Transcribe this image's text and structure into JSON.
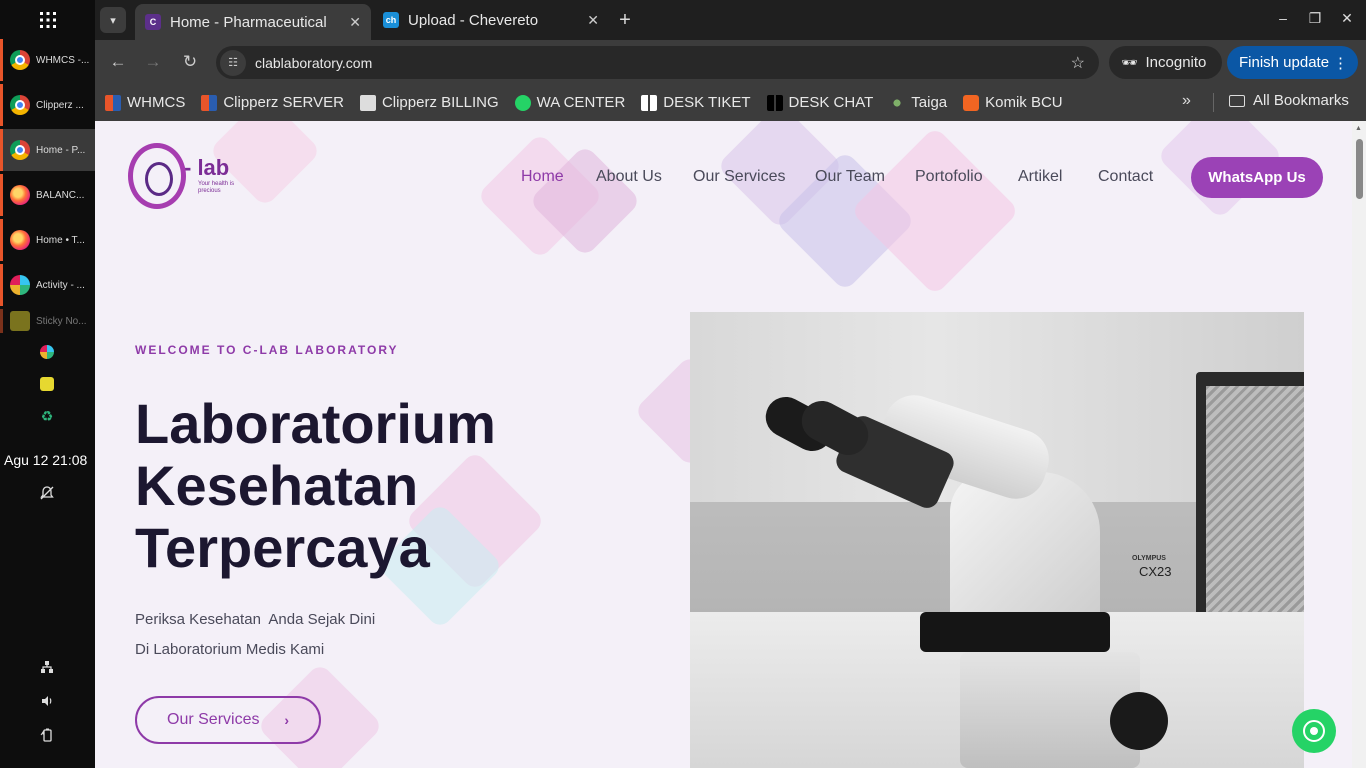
{
  "taskbar": {
    "items": [
      {
        "label": "WHMCS -...",
        "icon": "chrome-icon"
      },
      {
        "label": "Clipperz ...",
        "icon": "chrome-icon"
      },
      {
        "label": "Home - P...",
        "icon": "chrome-icon"
      },
      {
        "label": "BALANC...",
        "icon": "firefox-icon"
      },
      {
        "label": "Home • T...",
        "icon": "firefox-icon"
      },
      {
        "label": "Activity - ...",
        "icon": "slack-icon"
      },
      {
        "label": "Sticky No...",
        "icon": "sticky-notes-icon"
      }
    ],
    "clock": "Agu 12  21:08"
  },
  "browser": {
    "tabs": [
      {
        "title": "Home - Pharmaceutical C",
        "active": true
      },
      {
        "title": "Upload - Chevereto",
        "active": false
      }
    ],
    "url": "clablaboratory.com",
    "incognito_label": "Incognito",
    "update_label": "Finish update",
    "bookmarks": [
      {
        "label": "WHMCS",
        "color": "#e8552a"
      },
      {
        "label": "Clipperz SERVER",
        "color": "#e8552a"
      },
      {
        "label": "Clipperz BILLING",
        "color": "#dddddd"
      },
      {
        "label": "WA CENTER",
        "color": "#25d366"
      },
      {
        "label": "DESK TIKET",
        "color": "#ffffff"
      },
      {
        "label": "DESK CHAT",
        "color": "#ffffff"
      },
      {
        "label": "Taiga",
        "color": "#7fb069"
      },
      {
        "label": "Komik BCU",
        "color": "#f26522"
      }
    ],
    "all_bookmarks_label": "All Bookmarks"
  },
  "site": {
    "logo": {
      "name": "- lab",
      "tagline": "Your health is precious"
    },
    "nav": [
      "Home",
      "About Us",
      "Our Services",
      "Our Team",
      "Portofolio",
      "Artikel",
      "Contact"
    ],
    "whatsapp_button": "WhatsApp Us",
    "eyebrow": "WELCOME TO C-LAB LABORATORY",
    "headline": [
      "Laboratorium",
      "Kesehatan",
      "Terpercaya"
    ],
    "subtitle": [
      "Periksa Kesehatan  Anda Sejak Dini",
      "Di Laboratorium Medis Kami"
    ],
    "cta": "Our Services",
    "photo_brand": "OLYMPUS",
    "photo_model": "CX23",
    "accent": "#8e3aa8"
  }
}
